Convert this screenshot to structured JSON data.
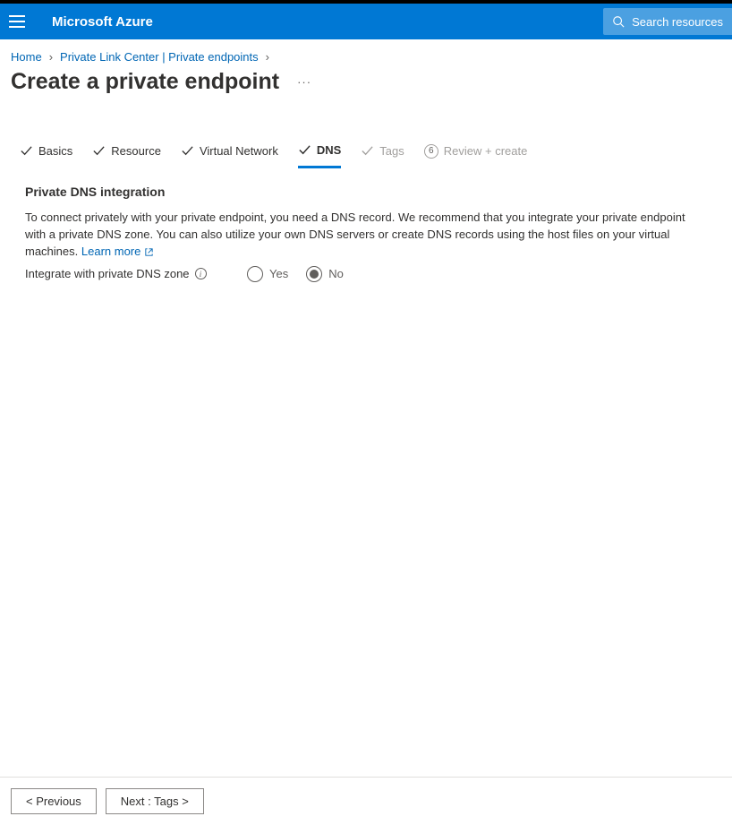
{
  "header": {
    "brand": "Microsoft Azure",
    "search_placeholder": "Search resources"
  },
  "breadcrumb": {
    "items": [
      "Home",
      "Private Link Center | Private endpoints"
    ]
  },
  "page": {
    "title": "Create a private endpoint"
  },
  "tabs": {
    "items": [
      {
        "label": "Basics",
        "state": "done"
      },
      {
        "label": "Resource",
        "state": "done"
      },
      {
        "label": "Virtual Network",
        "state": "done"
      },
      {
        "label": "DNS",
        "state": "active"
      },
      {
        "label": "Tags",
        "state": "pending"
      },
      {
        "label": "Review + create",
        "state": "numbered",
        "num": "6"
      }
    ]
  },
  "section": {
    "heading": "Private DNS integration",
    "desc": "To connect privately with your private endpoint, you need a DNS record. We recommend that you integrate your private endpoint with a private DNS zone. You can also utilize your own DNS servers or create DNS records using the host files on your virtual machines. ",
    "learn_more": "Learn more",
    "field_label": "Integrate with private DNS zone",
    "radio": {
      "yes": "Yes",
      "no": "No",
      "selected": "no"
    }
  },
  "footer": {
    "prev": "< Previous",
    "next": "Next : Tags >"
  }
}
